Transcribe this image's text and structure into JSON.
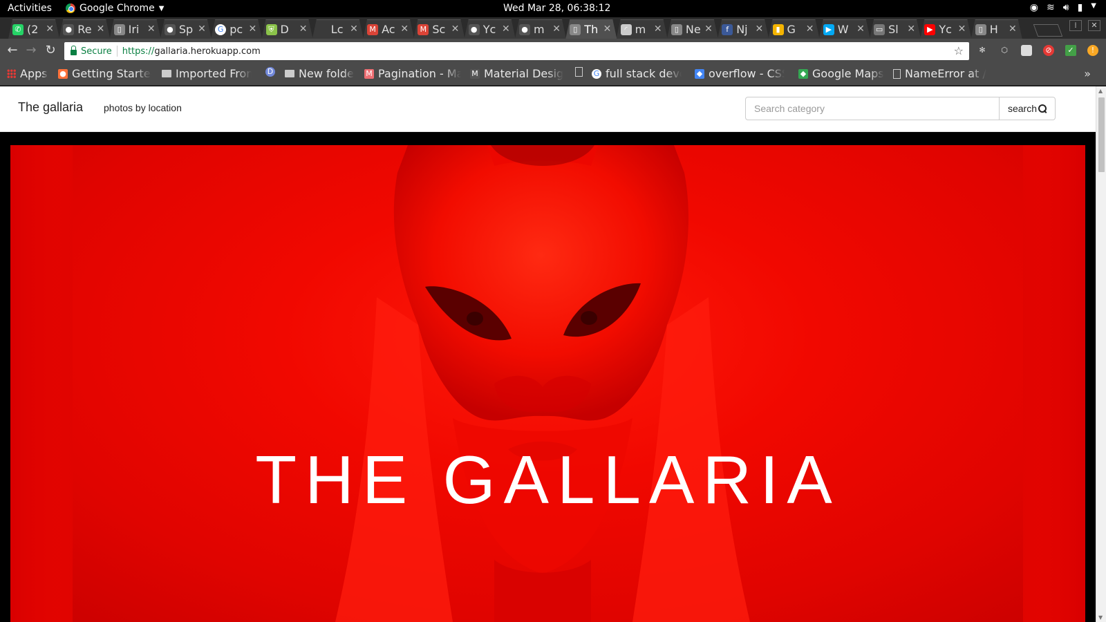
{
  "system_bar": {
    "activities": "Activities",
    "app_name": "Google Chrome",
    "clock": "Wed Mar 28, 06:38:12"
  },
  "tabs": [
    {
      "title": "(2",
      "icon": "whatsapp-icon",
      "color": "#25d366"
    },
    {
      "title": "Re",
      "icon": "reddit-icon",
      "color": "#555555"
    },
    {
      "title": "Iri",
      "icon": "document-icon",
      "color": "#888888"
    },
    {
      "title": "Sp",
      "icon": "github-icon",
      "color": "#555555"
    },
    {
      "title": "pc",
      "icon": "google-icon",
      "color": "#ffffff"
    },
    {
      "title": "D",
      "icon": "shield-icon",
      "color": "#8bc34a"
    },
    {
      "title": "Lc",
      "icon": "blank-icon",
      "color": "#3a3a3a"
    },
    {
      "title": "Ac",
      "icon": "gmail-icon",
      "color": "#db4437"
    },
    {
      "title": "Sc",
      "icon": "gmail-icon",
      "color": "#db4437"
    },
    {
      "title": "Yc",
      "icon": "github-icon",
      "color": "#555555"
    },
    {
      "title": "m",
      "icon": "github-icon",
      "color": "#555555"
    },
    {
      "title": "Th",
      "icon": "document-icon",
      "color": "#888888"
    },
    {
      "title": "m",
      "icon": "loading-icon",
      "color": "#cccccc"
    },
    {
      "title": "Ne",
      "icon": "document-icon",
      "color": "#888888"
    },
    {
      "title": "Nj",
      "icon": "facebook-icon",
      "color": "#3b5998"
    },
    {
      "title": "G",
      "icon": "keep-icon",
      "color": "#f4b400"
    },
    {
      "title": "W",
      "icon": "play-icon",
      "color": "#03a9f4"
    },
    {
      "title": "Sl",
      "icon": "monitor-icon",
      "color": "#777777"
    },
    {
      "title": "Yc",
      "icon": "youtube-icon",
      "color": "#ff0000"
    },
    {
      "title": "H",
      "icon": "document-icon",
      "color": "#888888"
    }
  ],
  "address_bar": {
    "secure_label": "Secure",
    "protocol": "https://",
    "host": "gallaria.herokuapp.com"
  },
  "bookmarks": [
    {
      "label": "Apps",
      "icon": "apps-grid-icon"
    },
    {
      "label": "Getting Started",
      "icon": "firefox-icon"
    },
    {
      "label": "Imported From",
      "icon": "folder-icon"
    },
    {
      "label": "",
      "icon": "discord-icon"
    },
    {
      "label": "New folder",
      "icon": "folder-icon"
    },
    {
      "label": "Pagination - Ma",
      "icon": "materialize-icon"
    },
    {
      "label": "Material Design",
      "icon": "material-icon"
    },
    {
      "label": "",
      "icon": "document-icon"
    },
    {
      "label": "full stack deve",
      "icon": "google-icon"
    },
    {
      "label": "overflow - CSS",
      "icon": "stackoverflow-icon"
    },
    {
      "label": "Google Maps",
      "icon": "maps-icon"
    },
    {
      "label": "NameError at /",
      "icon": "document-icon"
    }
  ],
  "site": {
    "brand": "The gallaria",
    "nav_link": "photos by location",
    "search_placeholder": "Search category",
    "search_button": "search",
    "hero_title": "THE GALLARIA"
  },
  "colors": {
    "hero_red": "#f10800",
    "secure_green": "#0b8043"
  }
}
